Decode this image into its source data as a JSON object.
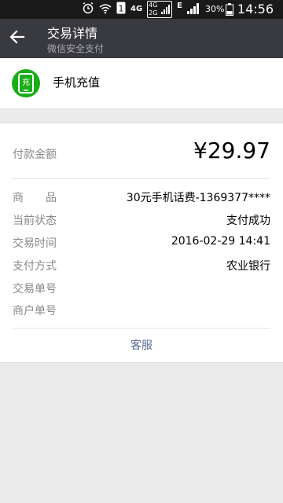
{
  "status_bar": {
    "network_4g": "4G",
    "network_4g_small": "4G",
    "network_2g_small": "2G",
    "edge": "E",
    "battery": "30%",
    "time": "14:56"
  },
  "app_bar": {
    "title": "交易详情",
    "subtitle": "微信安全支付"
  },
  "merchant": {
    "icon_char": "充",
    "name": "手机充值"
  },
  "payment": {
    "amount_label": "付款金额",
    "amount": "¥29.97"
  },
  "details": [
    {
      "label": "商　　品",
      "value": "30元手机话费-1369377****"
    },
    {
      "label": "当前状态",
      "value": "支付成功"
    },
    {
      "label": "交易时间",
      "value": "2016-02-29 14:41"
    },
    {
      "label": "支付方式",
      "value": "农业银行"
    },
    {
      "label": "交易单号",
      "value": ""
    },
    {
      "label": "商户单号",
      "value": ""
    }
  ],
  "customer_service": "客服",
  "colors": {
    "app_bar": "#393a3f",
    "brand_green": "#1aad19",
    "link": "#576b95"
  }
}
